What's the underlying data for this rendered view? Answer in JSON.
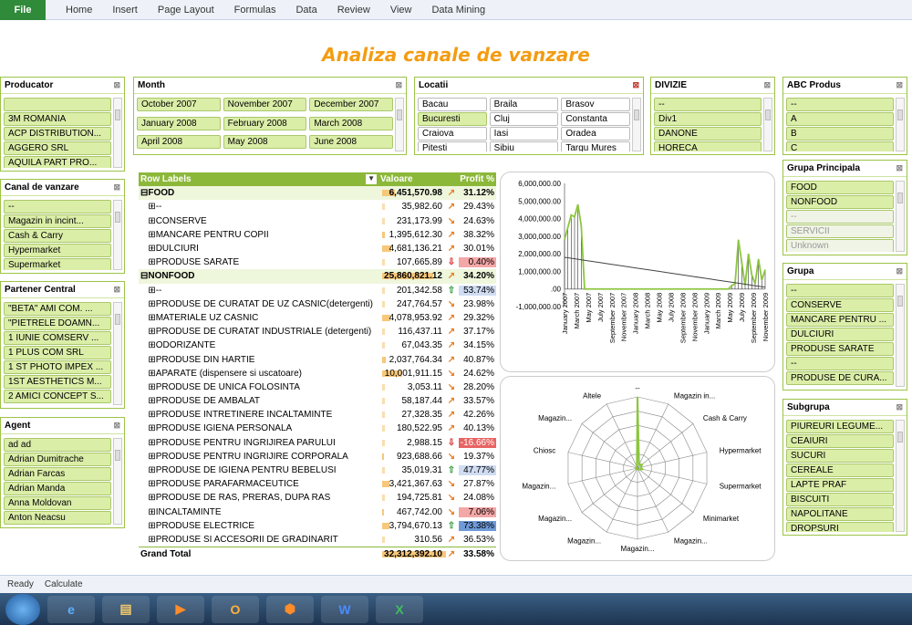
{
  "ribbon": {
    "file": "File",
    "tabs": [
      "Home",
      "Insert",
      "Page Layout",
      "Formulas",
      "Data",
      "Review",
      "View",
      "Data Mining"
    ]
  },
  "title": "Analiza canale de vanzare",
  "slicers": {
    "producator": {
      "title": "Producator",
      "items": [
        "",
        "3M ROMANIA",
        "ACP DISTRIBUTION...",
        "AGGERO SRL",
        "AQUILA PART PRO..."
      ]
    },
    "canal": {
      "title": "Canal de vanzare",
      "items": [
        "--",
        "Magazin in incint...",
        "Cash & Carry",
        "Hypermarket",
        "Supermarket"
      ]
    },
    "partener": {
      "title": "Partener Central",
      "items": [
        "\"BETA\" AMI COM. ...",
        "\"PIETRELE DOAMN...",
        "1 IUNIE COMSERV ...",
        "1 PLUS COM SRL",
        "1 ST PHOTO IMPEX ...",
        "1ST AESTHETICS M...",
        "2 AMICI CONCEPT S..."
      ]
    },
    "agent": {
      "title": "Agent",
      "items": [
        "ad ad",
        "Adrian  Dumitrache",
        "Adrian Farcas",
        "Adrian Manda",
        "Anna Moldovan",
        "Anton Neacsu"
      ]
    },
    "month": {
      "title": "Month",
      "items": [
        "October 2007",
        "November 2007",
        "December 2007",
        "January 2008",
        "February 2008",
        "March 2008",
        "April 2008",
        "May 2008",
        "June 2008"
      ]
    },
    "locatii": {
      "title": "Locatii",
      "items": [
        "Bacau",
        "Braila",
        "Brasov",
        "Bucuresti",
        "Cluj",
        "Constanta",
        "Craiova",
        "Iasi",
        "Oradea",
        "Pitesti",
        "Sibiu",
        "Targu Mures"
      ]
    },
    "divizie": {
      "title": "DIVIZIE",
      "items": [
        "--",
        "Div1",
        "DANONE",
        "HORECA"
      ]
    },
    "abc": {
      "title": "ABC Produs",
      "items": [
        "--",
        "A",
        "B",
        "C"
      ]
    },
    "grupaPrincipala": {
      "title": "Grupa Principala",
      "items": [
        "FOOD",
        "NONFOOD",
        "--",
        "SERVICII",
        "Unknown"
      ]
    },
    "grupa": {
      "title": "Grupa",
      "items": [
        "--",
        "CONSERVE",
        "MANCARE PENTRU ...",
        "DULCIURI",
        "PRODUSE SARATE",
        "--",
        "PRODUSE DE CURA..."
      ]
    },
    "subgrupa": {
      "title": "Subgrupa",
      "items": [
        "PIUREURI LEGUME...",
        "CEAIURI",
        "SUCURI",
        "CEREALE",
        "LAPTE PRAF",
        "BISCUITI",
        "NAPOLITANE",
        "DROPSURI"
      ]
    }
  },
  "pivot": {
    "header": {
      "labels": "Row Labels",
      "valoare": "Valoare",
      "profit": "Profit %"
    },
    "rows": [
      {
        "label": "⊟FOOD",
        "valoare": "6,451,570.98",
        "bar": 0.2,
        "icon": "↗",
        "profit": "31.12%",
        "type": "group"
      },
      {
        "label": "   ⊞--",
        "valoare": "35,982.60",
        "bar": 0,
        "icon": "↗",
        "profit": "29.43%"
      },
      {
        "label": "   ⊞CONSERVE",
        "valoare": "231,173.99",
        "bar": 0,
        "icon": "↘",
        "profit": "24.63%"
      },
      {
        "label": "   ⊞MANCARE PENTRU COPII",
        "valoare": "1,395,612.30",
        "bar": 0.04,
        "icon": "↗",
        "profit": "38.32%"
      },
      {
        "label": "   ⊞DULCIURI",
        "valoare": "4,681,136.21",
        "bar": 0.14,
        "icon": "↗",
        "profit": "30.01%"
      },
      {
        "label": "   ⊞PRODUSE SARATE",
        "valoare": "107,665.89",
        "bar": 0,
        "icon": "⇩",
        "profit": "0.40%",
        "hl": "red"
      },
      {
        "label": "⊟NONFOOD",
        "valoare": "25,860,821.12",
        "bar": 0.8,
        "icon": "↗",
        "profit": "34.20%",
        "type": "group"
      },
      {
        "label": "   ⊞--",
        "valoare": "201,342.58",
        "bar": 0,
        "icon": "⇧",
        "profit": "53.74%",
        "hl": "blue"
      },
      {
        "label": "   ⊞PRODUSE DE CURATAT DE UZ CASNIC(detergenti)",
        "valoare": "247,764.57",
        "bar": 0,
        "icon": "↘",
        "profit": "23.98%"
      },
      {
        "label": "   ⊞MATERIALE UZ CASNIC",
        "valoare": "4,078,953.92",
        "bar": 0.13,
        "icon": "↗",
        "profit": "29.32%"
      },
      {
        "label": "   ⊞PRODUSE DE CURATAT INDUSTRIALE (detergenti)",
        "valoare": "116,437.11",
        "bar": 0,
        "icon": "↗",
        "profit": "37.17%"
      },
      {
        "label": "   ⊞ODORIZANTE",
        "valoare": "67,043.35",
        "bar": 0,
        "icon": "↗",
        "profit": "34.15%"
      },
      {
        "label": "   ⊞PRODUSE DIN HARTIE",
        "valoare": "2,037,764.34",
        "bar": 0.06,
        "icon": "↗",
        "profit": "40.87%"
      },
      {
        "label": "   ⊞APARATE (dispensere si uscatoare)",
        "valoare": "10,001,911.15",
        "bar": 0.31,
        "icon": "↘",
        "profit": "24.62%"
      },
      {
        "label": "   ⊞PRODUSE DE UNICA FOLOSINTA",
        "valoare": "3,053.11",
        "bar": 0,
        "icon": "↘",
        "profit": "28.20%"
      },
      {
        "label": "   ⊞PRODUSE DE AMBALAT",
        "valoare": "58,187.44",
        "bar": 0,
        "icon": "↗",
        "profit": "33.57%"
      },
      {
        "label": "   ⊞PRODUSE INTRETINERE INCALTAMINTE",
        "valoare": "27,328.35",
        "bar": 0,
        "icon": "↗",
        "profit": "42.26%"
      },
      {
        "label": "   ⊞PRODUSE IGIENA PERSONALA",
        "valoare": "180,522.95",
        "bar": 0,
        "icon": "↗",
        "profit": "40.13%"
      },
      {
        "label": "   ⊞PRODUSE PENTRU INGRIJIREA PARULUI",
        "valoare": "2,988.15",
        "bar": 0,
        "icon": "⇩",
        "profit": "-16.66%",
        "hl": "red2"
      },
      {
        "label": "   ⊞PRODUSE PENTRU INGRIJIRE CORPORALA",
        "valoare": "923,688.66",
        "bar": 0.03,
        "icon": "↘",
        "profit": "19.37%"
      },
      {
        "label": "   ⊞PRODUSE DE IGIENA PENTRU BEBELUSI",
        "valoare": "35,019.31",
        "bar": 0,
        "icon": "⇧",
        "profit": "47.77%",
        "hl": "blue"
      },
      {
        "label": "   ⊞PRODUSE PARAFARMACEUTICE",
        "valoare": "3,421,367.63",
        "bar": 0.11,
        "icon": "↘",
        "profit": "27.87%"
      },
      {
        "label": "   ⊞PRODUSE DE RAS, PRERAS, DUPA RAS",
        "valoare": "194,725.81",
        "bar": 0,
        "icon": "↘",
        "profit": "24.08%"
      },
      {
        "label": "   ⊞INCALTAMINTE",
        "valoare": "467,742.00",
        "bar": 0.02,
        "icon": "↘",
        "profit": "7.06%",
        "hl": "red"
      },
      {
        "label": "   ⊞PRODUSE ELECTRICE",
        "valoare": "3,794,670.13",
        "bar": 0.12,
        "icon": "⇧",
        "profit": "73.38%",
        "hl": "blue2"
      },
      {
        "label": "   ⊞PRODUSE SI ACCESORII DE GRADINARIT",
        "valoare": "310.56",
        "bar": 0,
        "icon": "↗",
        "profit": "36.53%"
      },
      {
        "label": "Grand Total",
        "valoare": "32,312,392.10",
        "bar": 1,
        "icon": "↗",
        "profit": "33.58%",
        "type": "total"
      }
    ]
  },
  "chart_data": [
    {
      "type": "line",
      "y_ticks": [
        "6,000,000.00",
        "5,000,000.00",
        "4,000,000.00",
        "3,000,000.00",
        "2,000,000.00",
        "1,000,000.00",
        ".00",
        "-1,000,000.00"
      ],
      "ylim": [
        -1000000,
        6000000
      ],
      "x_labels": [
        "January 2007",
        "March 2007",
        "May 2007",
        "July 2007",
        "September 2007",
        "November 2007",
        "January 2008",
        "March 2008",
        "May 2008",
        "July 2008",
        "September 2008",
        "November 2008",
        "January 2009",
        "March 2009",
        "May 2009",
        "July 2009",
        "September 2009",
        "November 2009"
      ],
      "series": [
        {
          "values": [
            2800000,
            3500000,
            4200000,
            4100000,
            4800000,
            3600000,
            0,
            0,
            0,
            0,
            0,
            0,
            0,
            0,
            0,
            0,
            0,
            0,
            0,
            0,
            0,
            0,
            0,
            0,
            0,
            0,
            0,
            0,
            0,
            0,
            0,
            0,
            0,
            0,
            0,
            0,
            0,
            0,
            0,
            0,
            0,
            0,
            0,
            0,
            0,
            0,
            0,
            0,
            0,
            0,
            200000,
            300000,
            2800000,
            1500000,
            200000,
            2000000,
            800000,
            300000,
            1700000,
            500000,
            1100000
          ]
        },
        {
          "values": [
            1800000,
            1700000,
            1600000,
            1500000,
            1400000,
            1300000,
            1200000,
            1100000,
            1000000,
            900000,
            800000,
            700000,
            600000,
            500000,
            400000,
            300000,
            200000,
            100000
          ]
        }
      ]
    },
    {
      "type": "radar",
      "axes": [
        "--",
        "Magazin in...",
        "Cash & Carry",
        "Hypermarket",
        "Supermarket",
        "Minimarket",
        "Magazin...",
        "Magazin...",
        "Magazin...",
        "Magazin...",
        "Magazin...",
        "Chiosc",
        "Magazin...",
        "Altele"
      ],
      "values": [
        1,
        0.05,
        0.08,
        0.05,
        0.07,
        0.03,
        0.02,
        0.02,
        0.02,
        0.02,
        0.02,
        0.02,
        0.02,
        0.02
      ]
    }
  ],
  "status": {
    "ready": "Ready",
    "calculate": "Calculate"
  }
}
